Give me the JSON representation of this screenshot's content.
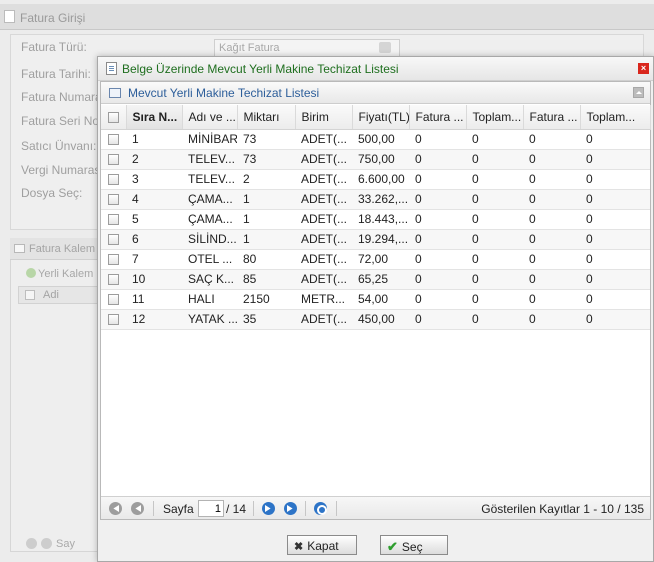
{
  "background_form": {
    "title": "Fatura Girişi",
    "fields": [
      {
        "label": "Fatura Türü:"
      },
      {
        "label": "Fatura Tarihi:"
      },
      {
        "label": "Fatura Numara"
      },
      {
        "label": "Fatura Seri No"
      },
      {
        "label": "Satıcı Ünvanı:"
      },
      {
        "label": "Vergi Numaras"
      },
      {
        "label": "Dosya Seç:"
      }
    ],
    "fatura_turu_value": "Kağıt Fatura",
    "section_title": "Fatura Kalem",
    "add_button": "Yerli Kalem",
    "grid_column": "Adi",
    "pager_label": "Say"
  },
  "dialog": {
    "title": "Belge Üzerinde Mevcut Yerli Makine Techizat Listesi",
    "close_glyph": "×",
    "grid_title": "Mevcut Yerli Makine Techizat Listesi",
    "columns": [
      "Sıra N...",
      "Adı ve ...",
      "Miktarı",
      "Birim",
      "Fiyatı(TL)",
      "Fatura ...",
      "Toplam...",
      "Fatura ...",
      "Toplam..."
    ],
    "rows": [
      [
        "1",
        "MİNİBAR",
        "73",
        "ADET(...",
        "500,00",
        "0",
        "0",
        "0",
        "0"
      ],
      [
        "2",
        "TELEV...",
        "73",
        "ADET(...",
        "750,00",
        "0",
        "0",
        "0",
        "0"
      ],
      [
        "3",
        "TELEV...",
        "2",
        "ADET(...",
        "6.600,00",
        "0",
        "0",
        "0",
        "0"
      ],
      [
        "4",
        "ÇAMA...",
        "1",
        "ADET(...",
        "33.262,...",
        "0",
        "0",
        "0",
        "0"
      ],
      [
        "5",
        "ÇAMA...",
        "1",
        "ADET(...",
        "18.443,...",
        "0",
        "0",
        "0",
        "0"
      ],
      [
        "6",
        "SİLİND...",
        "1",
        "ADET(...",
        "19.294,...",
        "0",
        "0",
        "0",
        "0"
      ],
      [
        "7",
        "OTEL ...",
        "80",
        "ADET(...",
        "72,00",
        "0",
        "0",
        "0",
        "0"
      ],
      [
        "10",
        "SAÇ K...",
        "85",
        "ADET(...",
        "65,25",
        "0",
        "0",
        "0",
        "0"
      ],
      [
        "11",
        "HALI",
        "2150",
        "METR...",
        "54,00",
        "0",
        "0",
        "0",
        "0"
      ],
      [
        "12",
        "YATAK ...",
        "35",
        "ADET(...",
        "450,00",
        "0",
        "0",
        "0",
        "0"
      ]
    ],
    "pager": {
      "page_label": "Sayfa",
      "current_page": "1",
      "total_text": "/ 14",
      "info": "Gösterilen Kayıtlar 1 - 10 / 135"
    },
    "buttons": {
      "close": "Kapat",
      "close_glyph": "✖",
      "select": "Seç",
      "select_glyph": "✔"
    }
  }
}
